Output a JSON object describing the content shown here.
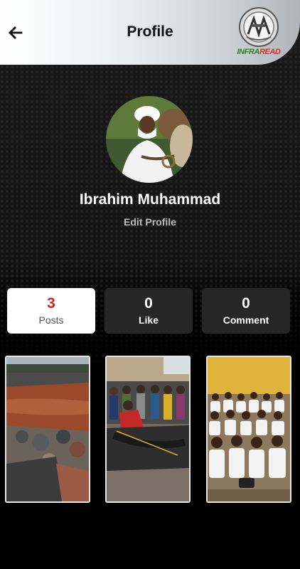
{
  "header": {
    "title": "Profile",
    "back_icon": "arrow-left-icon",
    "logo_text": "INFRAREAD"
  },
  "profile": {
    "name": "Ibrahim Muhammad",
    "edit_label": "Edit Profile"
  },
  "stats": [
    {
      "value": "3",
      "label": "Posts",
      "active": true
    },
    {
      "value": "0",
      "label": "Like",
      "active": false
    },
    {
      "value": "0",
      "label": "Comment",
      "active": false
    }
  ],
  "posts": [
    {
      "subject": "eroded road with muddy flood water"
    },
    {
      "subject": "people inspecting burnt ground"
    },
    {
      "subject": "children in white uniforms sitting on floor"
    }
  ],
  "colors": {
    "accent_red": "#c62828",
    "card_dark": "#262626",
    "logo_green": "#2e7d32",
    "logo_red": "#d32f2f"
  }
}
